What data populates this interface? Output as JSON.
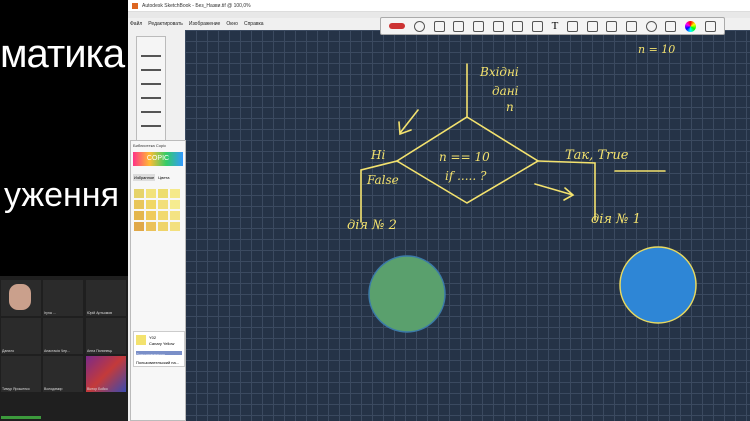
{
  "slide": {
    "line1": "матика",
    "line2": "уження"
  },
  "participants": [
    "Iryna ...",
    "Юрій Артьомов",
    "Данило",
    "Анастасія Чер...",
    "Анна Пилипець",
    "Тимур Ярошенко",
    "Володимир",
    "Віктор Бойко"
  ],
  "window": {
    "title": "Autodesk SketchBook - Без_Назви.tif @ 100,0%"
  },
  "menu": [
    "Файл",
    "Редактировать",
    "Изображение",
    "Окно",
    "Справка"
  ],
  "copic": {
    "title": "Библиотека Copic",
    "logo": "COPIC",
    "tab1": "Избранное",
    "tab2": "Цвета",
    "color_code": "Y02",
    "color_name": "Canary Yellow",
    "extra1": "Дополнительно",
    "extra2": "Пользовательский на..."
  },
  "drawing": {
    "n_value": "n = 10",
    "input1": "Вхідні",
    "input2": "дані",
    "input3": "n",
    "condition1": "n == 10",
    "condition2": "if ..... ?",
    "no1": "Ні",
    "no2": "False",
    "yes": "Так, True",
    "action2": "дія № 2",
    "action1": "дія № 1"
  },
  "colors": {
    "canvas": "#253347",
    "ink": "#f3e26e",
    "green_circle": "#5aa06d",
    "blue_circle": "#2e86d6"
  }
}
